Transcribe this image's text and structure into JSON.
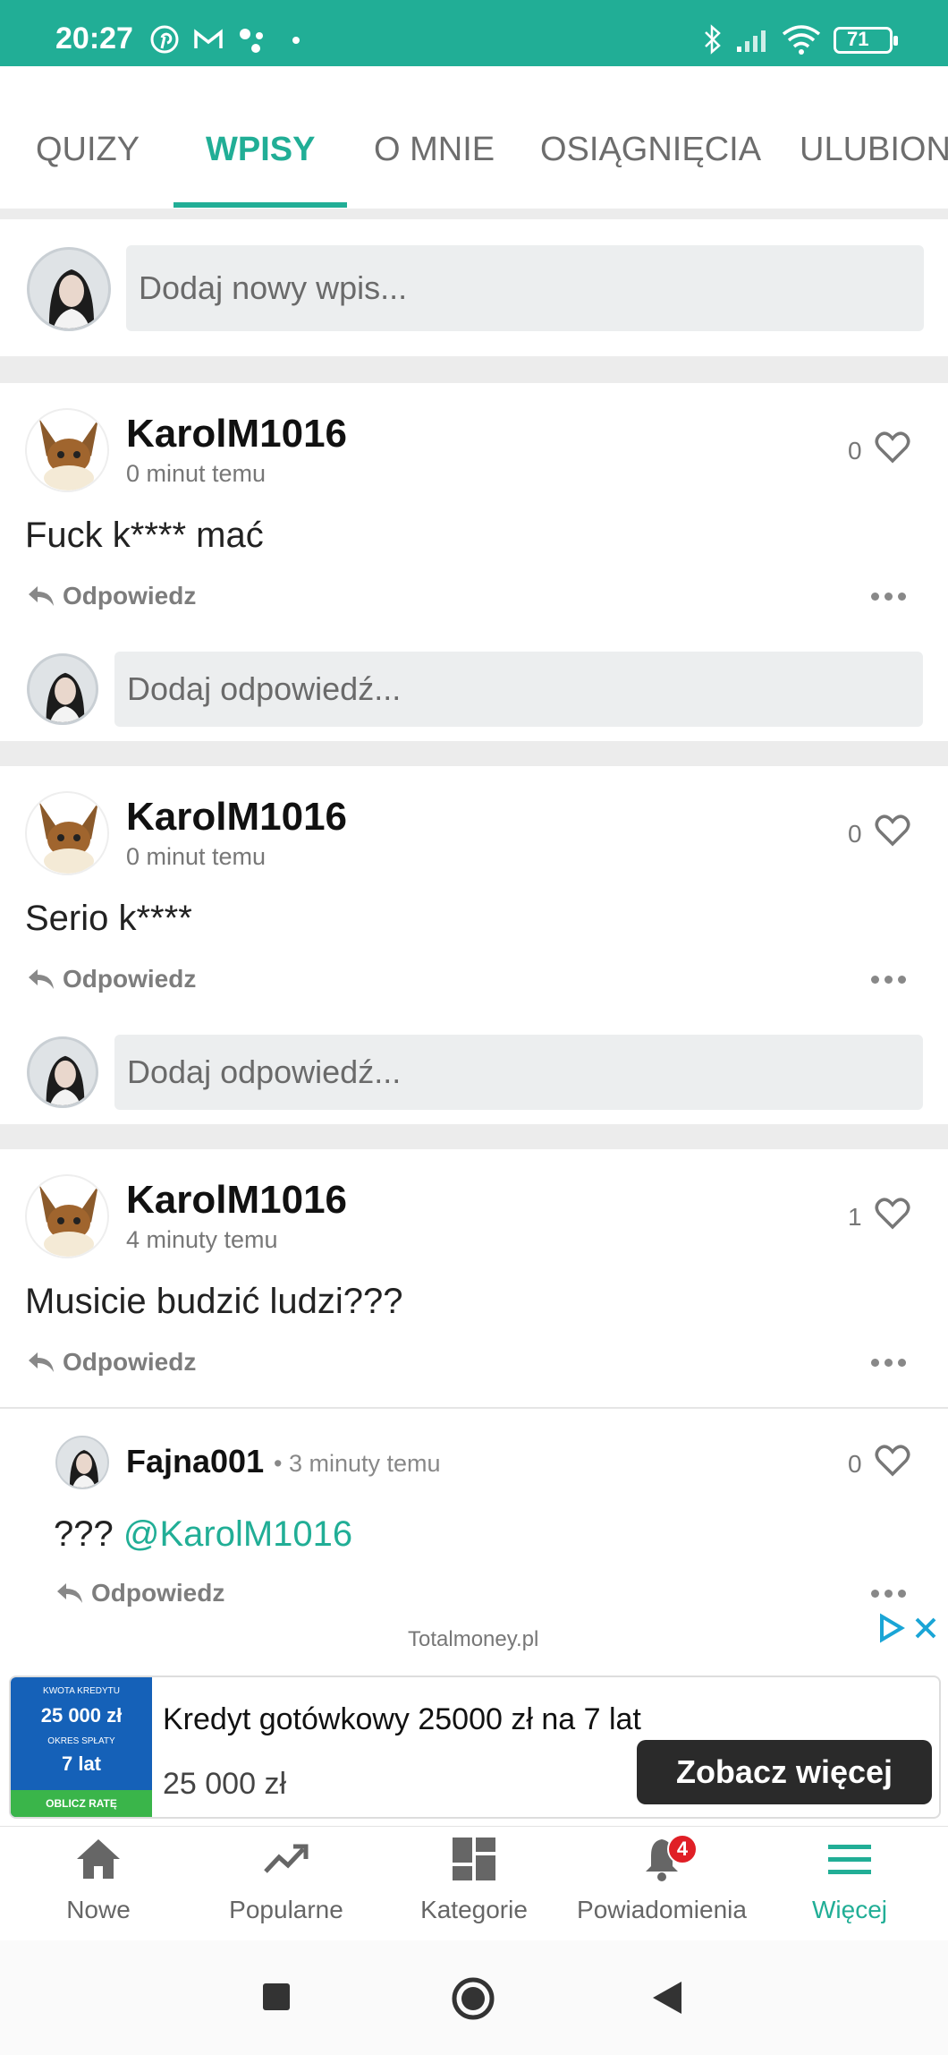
{
  "status_bar": {
    "time": "20:27",
    "battery": "71",
    "icons": [
      "pinterest-icon",
      "gmail-icon",
      "assistant-icon",
      "dot-icon",
      "bluetooth-icon",
      "signal-icon",
      "wifi-icon",
      "battery-icon"
    ]
  },
  "tabs": [
    {
      "label": "QUIZY",
      "active": false
    },
    {
      "label": "WPISY",
      "active": true
    },
    {
      "label": "O MNIE",
      "active": false
    },
    {
      "label": "OSIĄGNIĘCIA",
      "active": false
    },
    {
      "label": "ULUBION",
      "active": false
    }
  ],
  "new_post": {
    "placeholder": "Dodaj nowy wpis..."
  },
  "posts": [
    {
      "author": "KarolM1016",
      "time": "0 minut temu",
      "text": "Fuck k**** mać",
      "likes": "0",
      "reply_label": "Odpowiedz",
      "reply_placeholder": "Dodaj odpowiedź..."
    },
    {
      "author": "KarolM1016",
      "time": "0 minut temu",
      "text": "Serio k****",
      "likes": "0",
      "reply_label": "Odpowiedz",
      "reply_placeholder": "Dodaj odpowiedź..."
    },
    {
      "author": "KarolM1016",
      "time": "4 minuty temu",
      "text": "Musicie budzić ludzi???",
      "likes": "1",
      "reply_label": "Odpowiedz"
    }
  ],
  "comment": {
    "author": "Fajna001",
    "time": "• 3 minuty temu",
    "text_prefix": "???",
    "mention": "@KarolM1016",
    "likes": "0",
    "reply_label": "Odpowiedz"
  },
  "ad": {
    "source": "Totalmoney.pl",
    "thumb_label1": "KWOTA KREDYTU",
    "thumb_value1": "25 000 zł",
    "thumb_label2": "OKRES SPŁATY",
    "thumb_value2": "7 lat",
    "thumb_cta": "OBLICZ RATĘ",
    "title": "Kredyt gotówkowy 25000 zł na 7 lat",
    "price": "25 000 zł",
    "button": "Zobacz więcej"
  },
  "bottom_nav": [
    {
      "label": "Nowe",
      "icon": "home-icon",
      "active": false
    },
    {
      "label": "Popularne",
      "icon": "trending-icon",
      "active": false
    },
    {
      "label": "Kategorie",
      "icon": "dashboard-icon",
      "active": false
    },
    {
      "label": "Powiadomienia",
      "icon": "bell-icon",
      "active": false,
      "badge": "4"
    },
    {
      "label": "Więcej",
      "icon": "menu-icon",
      "active": true
    }
  ],
  "colors": {
    "accent": "#21ae96",
    "badge": "#e01f26",
    "ad_blue": "#1561b8"
  }
}
